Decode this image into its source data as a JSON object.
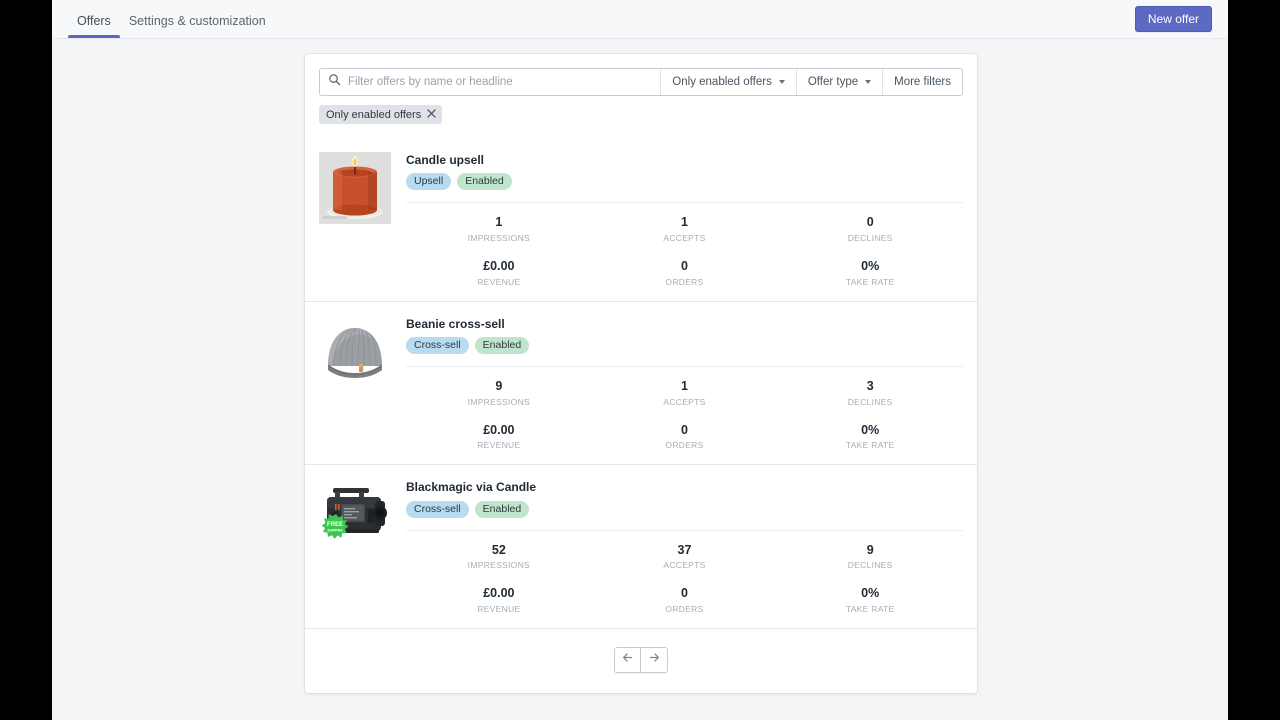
{
  "app": {
    "background_color": "#f4f5f7",
    "accent_color": "#5c6ac4",
    "frame_color": "#000000"
  },
  "topbar": {
    "tabs": [
      {
        "label": "Offers",
        "active": true
      },
      {
        "label": "Settings & customization",
        "active": false
      }
    ],
    "primary_action": {
      "label": "New offer"
    }
  },
  "filters": {
    "search": {
      "placeholder": "Filter offers by name or headline",
      "value": "",
      "icon": "search-icon"
    },
    "buttons": [
      {
        "label": "Only enabled offers",
        "has_caret": true
      },
      {
        "label": "Offer type",
        "has_caret": true
      },
      {
        "label": "More filters",
        "has_caret": false
      }
    ],
    "applied": [
      {
        "label": "Only enabled offers",
        "remove_icon": "close-icon"
      }
    ]
  },
  "stat_labels": {
    "impressions": "IMPRESSIONS",
    "accepts": "ACCEPTS",
    "declines": "DECLINES",
    "revenue": "REVENUE",
    "orders": "ORDERS",
    "take_rate": "TAKE RATE"
  },
  "offers": [
    {
      "title": "Candle upsell",
      "type_badge": "Upsell",
      "status_badge": "Enabled",
      "thumbnail": "candle-image",
      "stats": {
        "impressions": "1",
        "accepts": "1",
        "declines": "0",
        "revenue": "£0.00",
        "orders": "0",
        "take_rate": "0%"
      }
    },
    {
      "title": "Beanie cross-sell",
      "type_badge": "Cross-sell",
      "status_badge": "Enabled",
      "thumbnail": "beanie-image",
      "stats": {
        "impressions": "9",
        "accepts": "1",
        "declines": "3",
        "revenue": "£0.00",
        "orders": "0",
        "take_rate": "0%"
      }
    },
    {
      "title": "Blackmagic via Candle",
      "type_badge": "Cross-sell",
      "status_badge": "Enabled",
      "thumbnail": "camera-image",
      "badge_overlay": "FREE SHIPPING",
      "stats": {
        "impressions": "52",
        "accepts": "37",
        "declines": "9",
        "revenue": "£0.00",
        "orders": "0",
        "take_rate": "0%"
      }
    }
  ],
  "pagination": {
    "previous_icon": "arrow-left-icon",
    "next_icon": "arrow-right-icon"
  }
}
